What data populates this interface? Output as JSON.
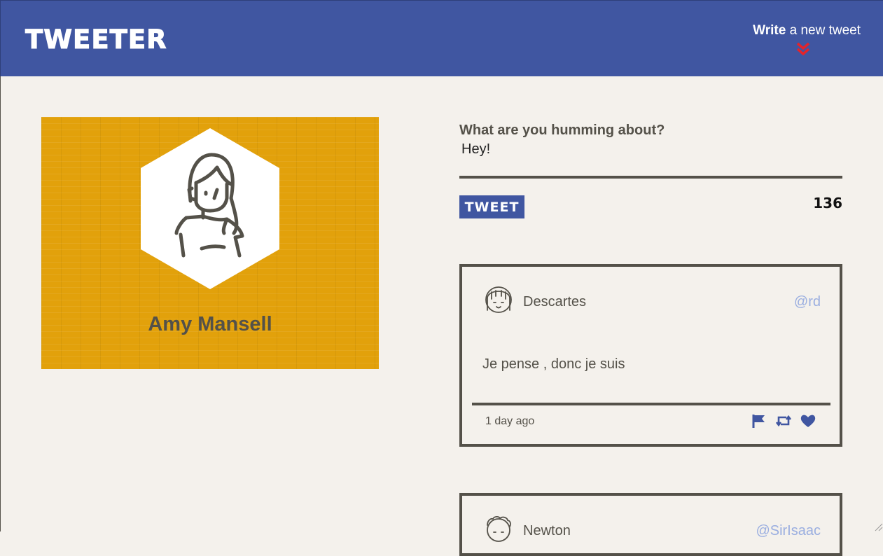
{
  "navbar": {
    "brand": "TWEETER",
    "write_bold": "Write",
    "write_rest": " a new tweet",
    "chevron_color": "#e3242b"
  },
  "profile": {
    "name": "Amy Mansell",
    "background_color": "#e2a10b",
    "avatar_icon": "woman-avatar-icon"
  },
  "compose": {
    "label": "What are you humming about?",
    "value": "Hey!",
    "button_label": "TWEET",
    "counter": "136"
  },
  "tweets": [
    {
      "name": "Descartes",
      "handle": "@rd",
      "text": "Je pense , donc je suis",
      "time": "1 day ago",
      "avatar_icon": "girl-avatar-icon",
      "actions": [
        "flag-icon",
        "retweet-icon",
        "heart-icon"
      ]
    },
    {
      "name": "Newton",
      "handle": "@SirIsaac",
      "avatar_icon": "curly-hair-avatar-icon"
    }
  ],
  "colors": {
    "primary": "#4056a1",
    "text": "#545149",
    "handle": "#9aaee0",
    "background": "#f4f1ec"
  }
}
